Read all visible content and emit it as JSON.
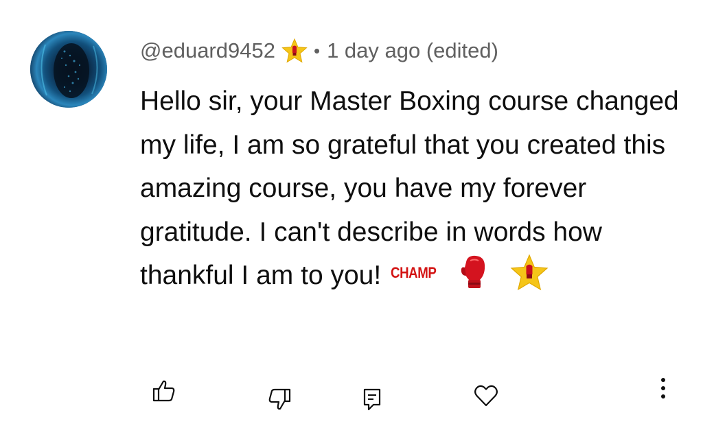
{
  "comment": {
    "username": "@eduard9452",
    "separator": "•",
    "timestamp": "1 day ago (edited)",
    "text": "Hello sir, your Master Boxing course changed my life, I am so grateful that you created this amazing course, you have my forever gratitude. I can't describe in words how thankful I am to you!",
    "badge_text": "CHAMP",
    "badges": [
      "star-glove-icon",
      "boxing-glove-icon"
    ]
  },
  "actions": [
    {
      "name": "like",
      "icon": "thumbs-up-icon"
    },
    {
      "name": "dislike",
      "icon": "thumbs-down-icon"
    },
    {
      "name": "reply",
      "icon": "reply-comment-icon"
    },
    {
      "name": "heart",
      "icon": "heart-icon"
    },
    {
      "name": "more",
      "icon": "more-vertical-icon"
    }
  ],
  "colors": {
    "text_primary": "#0f0f0f",
    "text_secondary": "#606060",
    "champ_red": "#d31414",
    "star_gold": "#f5c518"
  }
}
